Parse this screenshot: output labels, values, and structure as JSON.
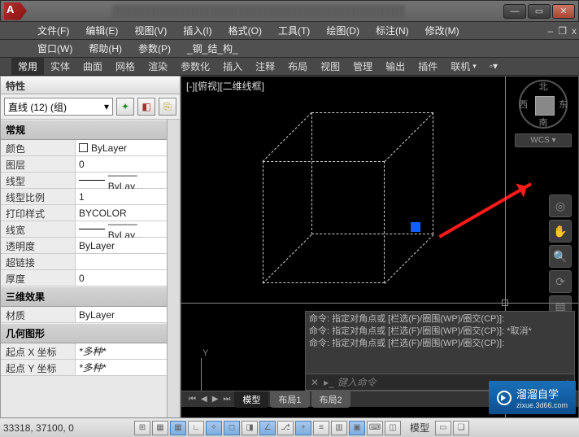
{
  "menus": {
    "row1": [
      "文件(F)",
      "编辑(E)",
      "视图(V)",
      "插入(I)",
      "格式(O)",
      "工具(T)",
      "绘图(D)",
      "标注(N)",
      "修改(M)"
    ],
    "row2": [
      "窗口(W)",
      "帮助(H)",
      "参数(P)",
      "_钢_结_构_"
    ]
  },
  "ribbon": [
    "常用",
    "实体",
    "曲面",
    "网格",
    "渲染",
    "参数化",
    "插入",
    "注释",
    "布局",
    "视图",
    "管理",
    "输出",
    "插件",
    "联机"
  ],
  "palette": {
    "title": "特性",
    "selection": "直线 (12) (组)",
    "cats": [
      {
        "name": "常规",
        "rows": [
          {
            "k": "颜色",
            "v": "ByLayer",
            "swatch": true
          },
          {
            "k": "图层",
            "v": "0"
          },
          {
            "k": "线型",
            "v": "——— ByLay...",
            "line": true
          },
          {
            "k": "线型比例",
            "v": "1"
          },
          {
            "k": "打印样式",
            "v": "BYCOLOR"
          },
          {
            "k": "线宽",
            "v": "——— ByLay...",
            "line": true
          },
          {
            "k": "透明度",
            "v": "ByLayer"
          },
          {
            "k": "超链接",
            "v": ""
          },
          {
            "k": "厚度",
            "v": "0"
          }
        ]
      },
      {
        "name": "三维效果",
        "rows": [
          {
            "k": "材质",
            "v": "ByLayer"
          }
        ]
      },
      {
        "name": "几何图形",
        "rows": [
          {
            "k": "起点 X 坐标",
            "v": "*多种*",
            "star": true
          },
          {
            "k": "起点 Y 坐标",
            "v": "*多种*",
            "star": true
          }
        ]
      }
    ]
  },
  "viewport_label": "[-][俯视][二维线框]",
  "compass": {
    "n": "北",
    "s": "南",
    "e": "东",
    "w": "西",
    "wcs": "WCS"
  },
  "cmd_history": [
    "命令: 指定对角点或 [栏选(F)/圈围(WP)/圈交(CP)]:",
    "命令: 指定对角点或 [栏选(F)/圈围(WP)/圈交(CP)]: *取消*",
    "命令: 指定对角点或 [栏选(F)/圈围(WP)/圈交(CP)]:"
  ],
  "cmd_prompt": "▸_",
  "cmd_placeholder": "键入命令",
  "model_tabs": [
    "模型",
    "布局1",
    "布局2"
  ],
  "status": {
    "coords": "33318, 37100, 0",
    "model": "模型"
  },
  "watermark": {
    "brand": "溜溜自学",
    "url": "zixue.3d66.com"
  }
}
